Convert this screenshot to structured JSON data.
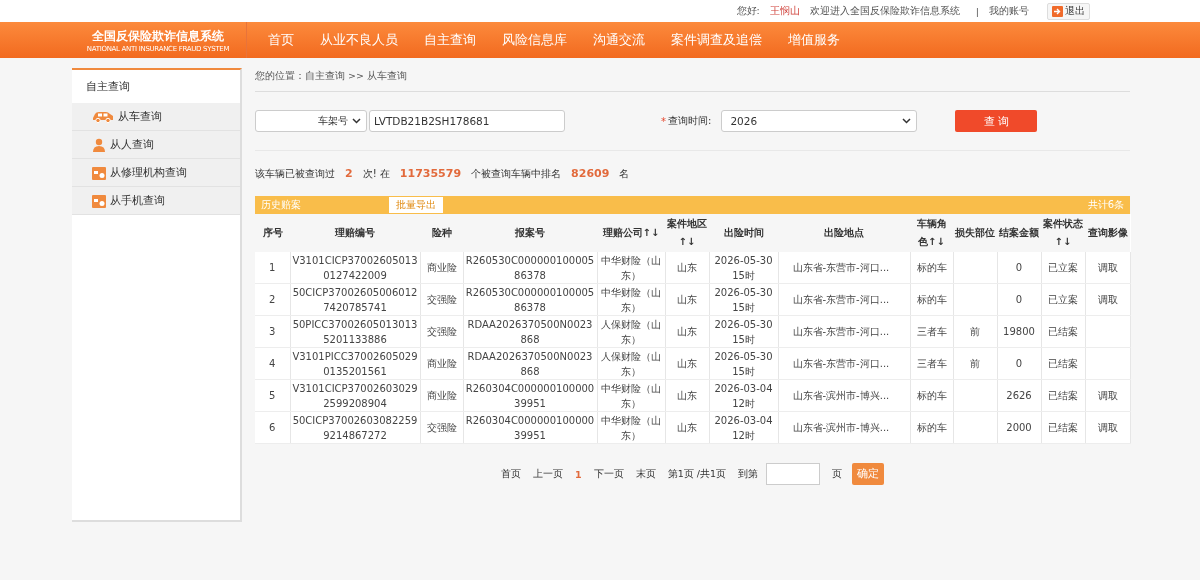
{
  "top_bar": {
    "greeting": "您好:",
    "user": "王悯山",
    "welcome": "欢迎进入全国反保险欺诈信息系统",
    "separator": "|",
    "account_link": "我的账号",
    "logout": "退出"
  },
  "header": {
    "logo_title": "全国反保险欺诈信息系统",
    "logo_subtitle": "NATIONAL ANTI INSURANCE FRAUD SYSTEM",
    "nav": [
      "首页",
      "从业不良人员",
      "自主查询",
      "风险信息库",
      "沟通交流",
      "案件调查及追偿",
      "增值服务"
    ]
  },
  "sidebar": {
    "title": "自主查询",
    "items": [
      {
        "label": "从车查询",
        "kind": "car"
      },
      {
        "label": "从人查询",
        "kind": "person"
      },
      {
        "label": "从修理机构查询",
        "kind": "calendar"
      },
      {
        "label": "从手机查询",
        "kind": "calendar"
      }
    ]
  },
  "breadcrumb": "您的位置：自主查询 >> 从车查询",
  "search": {
    "type_select": "车架号",
    "vin": "LVTDB21B2SH178681",
    "required_mark": "*",
    "time_label": "查询时间:",
    "time_select": "2026",
    "button": "查 询"
  },
  "summary": {
    "parts": [
      "该车辆已被查询过",
      "2",
      "次! 在",
      "11735579",
      "个被查询车辆中排名",
      "82609",
      "名"
    ]
  },
  "history": {
    "title": "历史赔案",
    "export_button": "批量导出",
    "total": "共计6条",
    "columns": [
      "序号",
      "理赔编号",
      "险种",
      "报案号",
      "理赔公司↑↓",
      "案件地区↑↓",
      "出险时间",
      "出险地点",
      "车辆角色↑↓",
      "损失部位",
      "结案金额",
      "案件状态↑↓",
      "查询影像"
    ],
    "rows": [
      [
        "1",
        "V3101CICP370026050130127422009",
        "商业险",
        "R260530C00000010000586378",
        "中华财险（山东）",
        "山东",
        "2026-05-30 15时",
        "山东省-东营市-河口...",
        "标的车",
        "",
        "0",
        "已立案",
        "调取"
      ],
      [
        "2",
        "50CICP370026050060127420785741",
        "交强险",
        "R260530C00000010000586378",
        "中华财险（山东）",
        "山东",
        "2026-05-30 15时",
        "山东省-东营市-河口...",
        "标的车",
        "",
        "0",
        "已立案",
        "调取"
      ],
      [
        "3",
        "50PICC370026050130135201133886",
        "交强险",
        "RDAA2026370500N0023868",
        "人保财险（山东）",
        "山东",
        "2026-05-30 15时",
        "山东省-东营市-河口...",
        "三者车",
        "前",
        "19800",
        "已结案",
        ""
      ],
      [
        "4",
        "V3101PICC370026050290135201561",
        "商业险",
        "RDAA2026370500N0023868",
        "人保财险（山东）",
        "山东",
        "2026-05-30 15时",
        "山东省-东营市-河口...",
        "三者车",
        "前",
        "0",
        "已结案",
        ""
      ],
      [
        "5",
        "V3101CICP370026030292599208904",
        "商业险",
        "R260304C00000010000039951",
        "中华财险（山东）",
        "山东",
        "2026-03-04 12时",
        "山东省-滨州市-博兴...",
        "标的车",
        "",
        "2626",
        "已结案",
        "调取"
      ],
      [
        "6",
        "50CICP370026030822599214867272",
        "交强险",
        "R260304C00000010000039951",
        "中华财险（山东）",
        "山东",
        "2026-03-04 12时",
        "山东省-滨州市-博兴...",
        "标的车",
        "",
        "2000",
        "已结案",
        "调取"
      ]
    ]
  },
  "pager": {
    "links": [
      {
        "label": "首页",
        "selected": false
      },
      {
        "label": "上一页",
        "selected": false
      },
      {
        "label": "1",
        "selected": true
      },
      {
        "label": "下一页",
        "selected": false
      },
      {
        "label": "末页",
        "selected": false
      }
    ],
    "info": "第1页 /共1页",
    "goto_label": "到第",
    "page_unit": "页",
    "confirm": "确定"
  }
}
